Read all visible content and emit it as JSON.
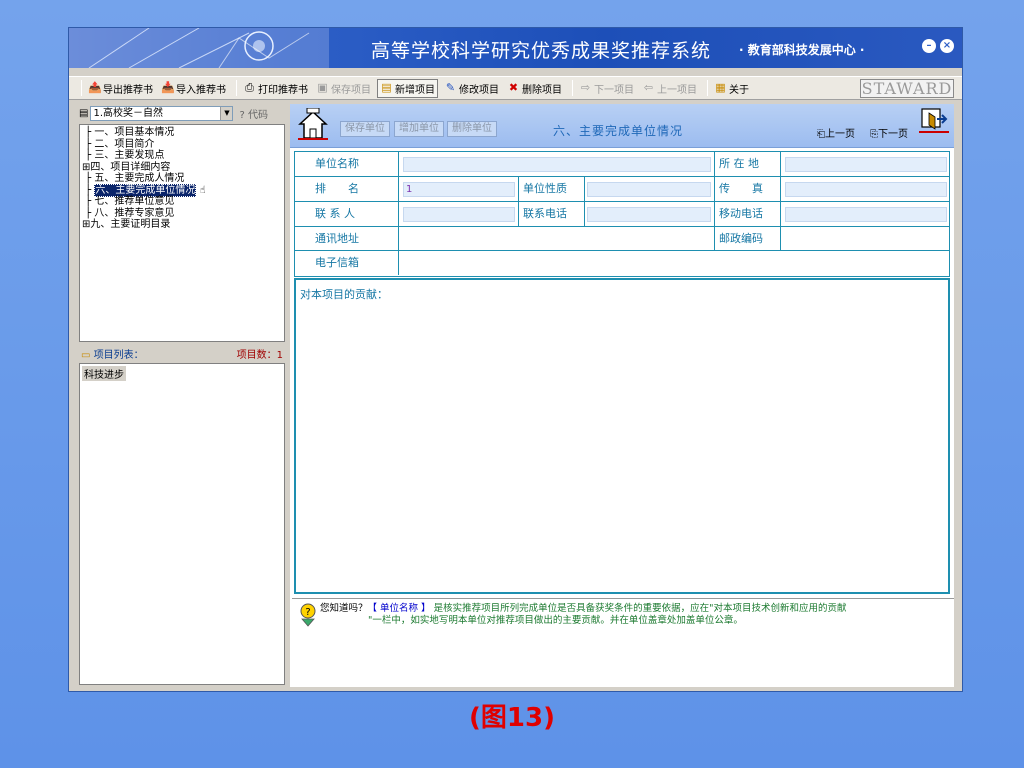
{
  "window": {
    "title": "高等学校科学研究优秀成果奖推荐系统",
    "subtitle": "· 教育部科技发展中心 ·"
  },
  "toolbar": {
    "items": [
      {
        "label": "导出推荐书",
        "icon": "export-icon",
        "disabled": false
      },
      {
        "label": "导入推荐书",
        "icon": "import-icon",
        "disabled": false
      },
      {
        "label": "打印推荐书",
        "icon": "print-icon",
        "disabled": false
      },
      {
        "label": "保存项目",
        "icon": "save-icon",
        "disabled": true
      },
      {
        "label": "新增项目",
        "icon": "new-icon",
        "disabled": false
      },
      {
        "label": "修改项目",
        "icon": "edit-icon",
        "disabled": false
      },
      {
        "label": "删除项目",
        "icon": "delete-icon",
        "disabled": false
      },
      {
        "label": "下一项目",
        "icon": "arrow-right-icon",
        "disabled": true
      },
      {
        "label": "上一项目",
        "icon": "arrow-left-icon",
        "disabled": true
      },
      {
        "label": "关于",
        "icon": "about-icon",
        "disabled": false
      }
    ],
    "brand": "STAWARD"
  },
  "left": {
    "combo_value": "1.高校奖－自然",
    "code_label": "代码",
    "tree": [
      {
        "label": "一、项目基本情况",
        "prefix": "├"
      },
      {
        "label": "二、项目简介",
        "prefix": "├"
      },
      {
        "label": "三、主要发现点",
        "prefix": "├"
      },
      {
        "label": "四、项目详细内容",
        "prefix": "⊞"
      },
      {
        "label": "五、主要完成人情况",
        "prefix": "├"
      },
      {
        "label": "六、主要完成单位情况",
        "prefix": "├"
      },
      {
        "label": "七、推荐单位意见",
        "prefix": "├"
      },
      {
        "label": "八、推荐专家意见",
        "prefix": "├"
      },
      {
        "label": "九、主要证明目录",
        "prefix": "⊞"
      }
    ],
    "project_list_label": "项目列表：",
    "project_count_label": "项目数：",
    "project_count": "1",
    "projects": [
      "科技进步"
    ]
  },
  "right": {
    "buttons": {
      "save_unit": "保存单位",
      "add_unit": "增加单位",
      "delete_unit": "删除单位"
    },
    "section_title": "六、主要完成单位情况",
    "nav_prev": "上一页",
    "nav_next": "下一页",
    "form": {
      "unit_name_label": "单位名称",
      "location_label": "所 在 地",
      "rank_label": "排　　名",
      "rank_value": "1",
      "unit_type_label": "单位性质",
      "fax_label": "传　　真",
      "contact_label": "联 系 人",
      "phone_label": "联系电话",
      "mobile_label": "移动电话",
      "address_label": "通讯地址",
      "postcode_label": "邮政编码",
      "email_label": "电子信箱"
    },
    "contribution_label": "对本项目的贡献：",
    "tip_question": "您知道吗？",
    "tip_highlight": "【 单位名称 】",
    "tip_line1": "是核实推荐项目所列完成单位是否具备获奖条件的重要依据，应在\"对本项目技术创新和应用的贡献",
    "tip_line2": "\"一栏中，如实地写明本单位对推荐项目做出的主要贡献。并在单位盖章处加盖单位公章。"
  },
  "caption": "(图13)"
}
